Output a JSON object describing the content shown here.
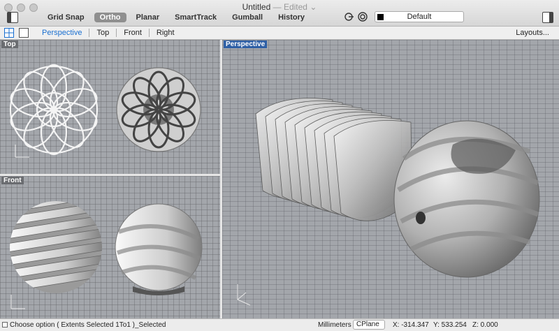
{
  "window": {
    "title": "Untitled",
    "edited": "— Edited",
    "chevron": "⌄"
  },
  "toolbar": {
    "modes": [
      {
        "label": "Grid Snap",
        "active": false
      },
      {
        "label": "Ortho",
        "active": true
      },
      {
        "label": "Planar",
        "active": false
      },
      {
        "label": "SmartTrack",
        "active": false
      },
      {
        "label": "Gumball",
        "active": false
      },
      {
        "label": "History",
        "active": false
      }
    ],
    "layer_name": "Default"
  },
  "views": {
    "tabs": [
      "Perspective",
      "Top",
      "Front",
      "Right"
    ],
    "active_tab": "Perspective",
    "layouts": "Layouts..."
  },
  "viewports": {
    "top": "Top",
    "front": "Front",
    "perspective": "Perspective"
  },
  "status": {
    "message": "Choose option ( Extents Selected 1To1 )_Selected",
    "units": "Millimeters",
    "cplane": "CPlane",
    "x": "X: -314.347",
    "y": "Y: 533.254",
    "z": "Z: 0.000"
  },
  "colors": {
    "accent": "#1a6fd0",
    "viewport_label_active": "#2e5fa5",
    "viewport_bg": "#a3a6ab"
  }
}
